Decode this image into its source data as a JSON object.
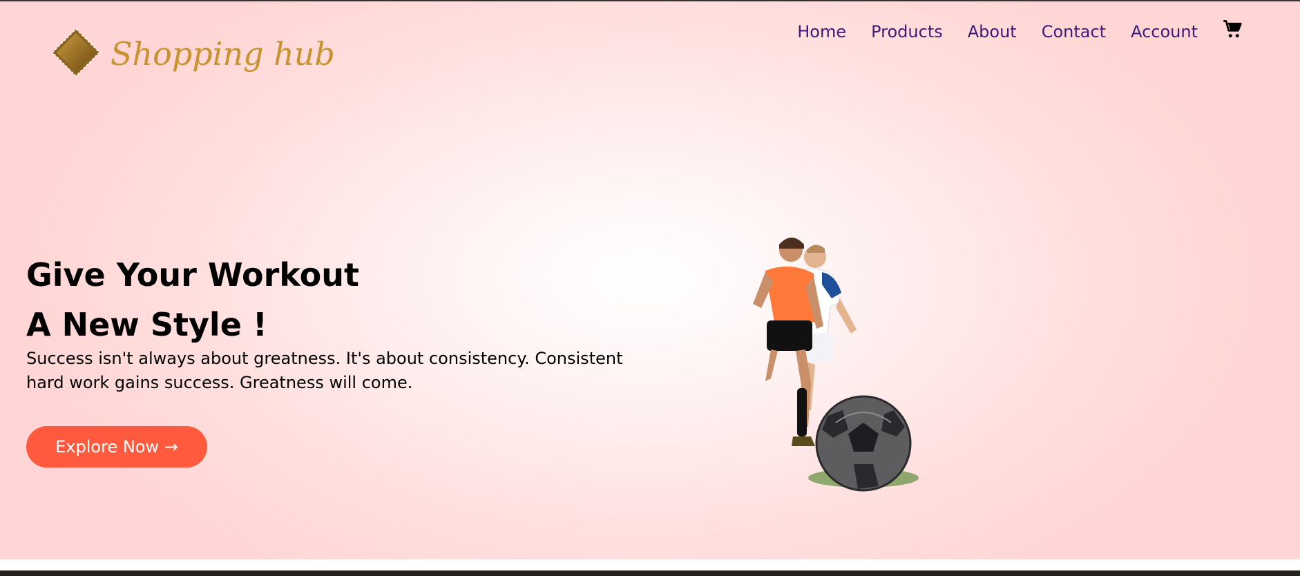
{
  "brand": {
    "name": "Shopping hub",
    "colors": {
      "logo": "#c8922e",
      "nav": "#3d1a7a",
      "button": "#ff5a3d"
    }
  },
  "nav": {
    "items": [
      "Home",
      "Products",
      "About",
      "Contact",
      "Account"
    ],
    "cart_icon": "cart-icon"
  },
  "hero": {
    "headline_line1": "Give Your Workout",
    "headline_line2": "A New Style !",
    "subtitle": "Success isn't always about greatness. It's about consistency. Consistent hard work gains success. Greatness will come.",
    "cta_label": "Explore Now →",
    "image": "soccer-players-image"
  }
}
